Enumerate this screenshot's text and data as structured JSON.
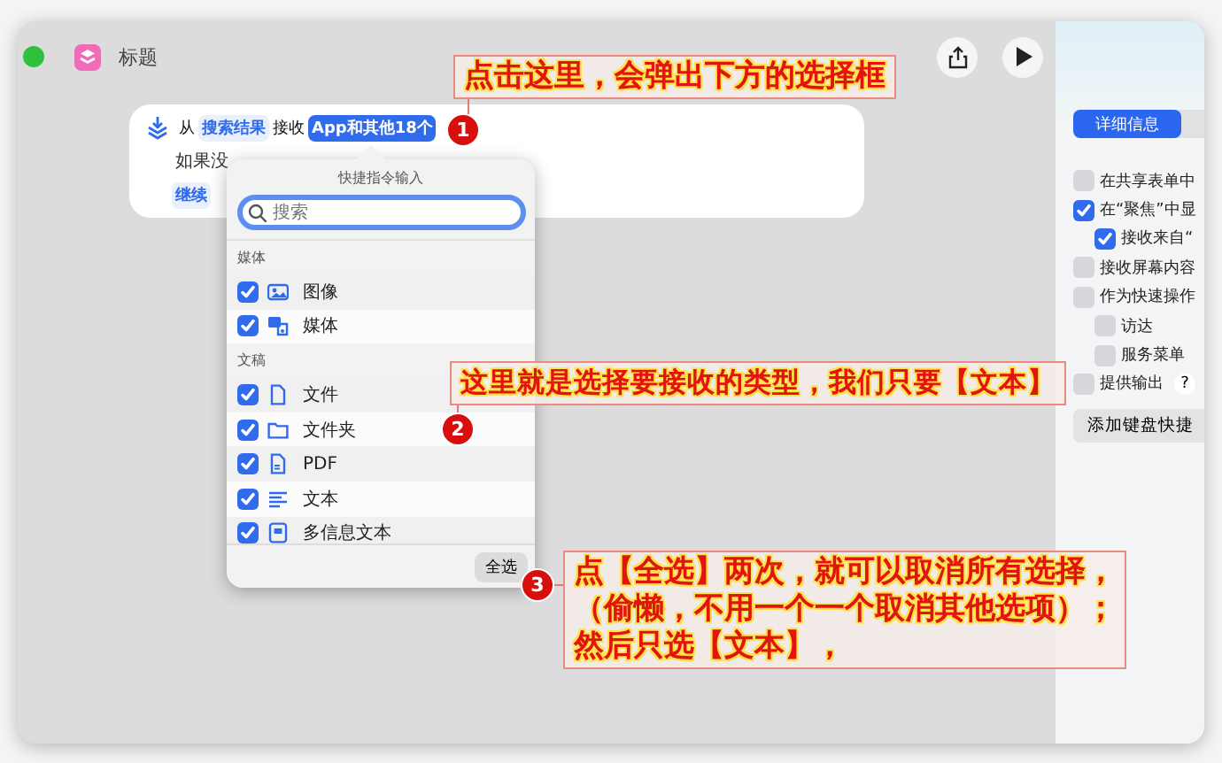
{
  "window": {
    "title": "标题"
  },
  "action": {
    "parts": [
      {
        "kind": "text",
        "text": "从"
      },
      {
        "kind": "token",
        "text": "搜索结果"
      },
      {
        "kind": "text",
        "text": "接收"
      },
      {
        "kind": "token-active",
        "text": "App和其他18个"
      }
    ],
    "fallback_text": "如果没",
    "fallback_token": "继续"
  },
  "popover": {
    "title": "快捷指令输入",
    "search": {
      "placeholder": "搜索"
    },
    "sections": [
      {
        "label": "媒体",
        "items": [
          {
            "label": "图像",
            "checked": true
          },
          {
            "label": "媒体",
            "checked": true
          }
        ]
      },
      {
        "label": "文稿",
        "items": [
          {
            "label": "文件",
            "checked": true
          },
          {
            "label": "文件夹",
            "checked": true
          },
          {
            "label": "PDF",
            "checked": true
          },
          {
            "label": "文本",
            "checked": true
          },
          {
            "label": "多信息文本",
            "checked": true
          }
        ]
      }
    ],
    "footer_button": "全选"
  },
  "sidebar": {
    "tabs": [
      {
        "label": "详细信息",
        "selected": true
      }
    ],
    "options": [
      {
        "label": "在共享表单中",
        "checked": false
      },
      {
        "label": "在“聚焦”中显",
        "checked": true,
        "children": [
          {
            "label": "接收来自“",
            "checked": true
          }
        ]
      },
      {
        "label": "接收屏幕内容",
        "checked": false
      },
      {
        "label": "作为快速操作",
        "checked": false,
        "children": [
          {
            "label": "访达",
            "checked": false
          },
          {
            "label": "服务菜单",
            "checked": false
          }
        ]
      },
      {
        "label": "提供输出",
        "checked": false,
        "help": "?"
      }
    ],
    "button": "添加键盘快捷"
  },
  "annotations": [
    {
      "number": "1",
      "lines": [
        "点击这里，会弹出下方的选择框"
      ]
    },
    {
      "number": "2",
      "lines": [
        "这里就是选择要接收的类型，我们只要【文本】"
      ]
    },
    {
      "number": "3",
      "lines": [
        "点【全选】两次，就可以取消所有选择，",
        "（偷懒，不用一个一个取消其他选项）；",
        "然后只选【文本】，"
      ]
    }
  ]
}
